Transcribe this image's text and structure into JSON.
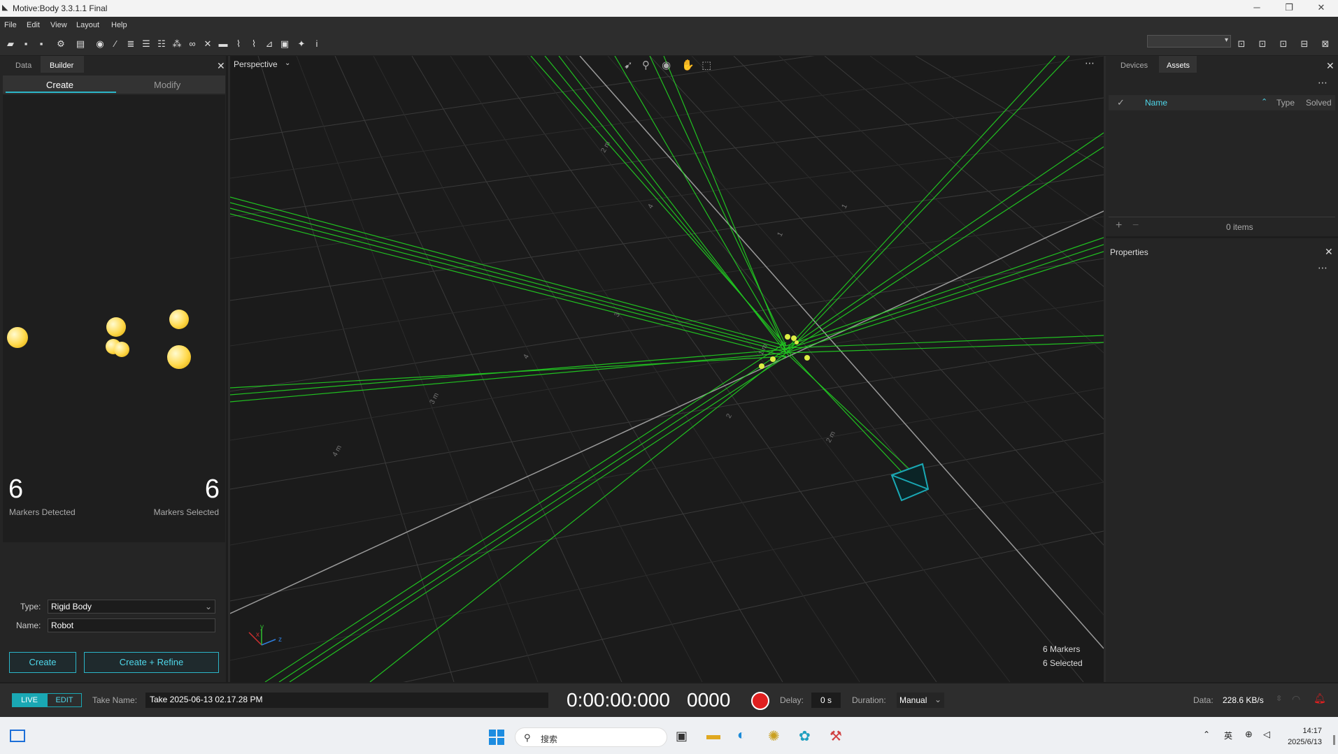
{
  "window": {
    "title": "Motive:Body 3.3.1.1 Final",
    "min": "─",
    "restore": "❐",
    "close": "✕"
  },
  "menu": [
    "File",
    "Edit",
    "View",
    "Layout",
    "Help"
  ],
  "left_panel": {
    "tabs": [
      "Data",
      "Builder"
    ],
    "subtabs": [
      "Create",
      "Modify"
    ],
    "markers_detected": "6",
    "markers_detected_label": "Markers Detected",
    "markers_selected": "6",
    "markers_selected_label": "Markers Selected",
    "type_label": "Type:",
    "type_value": "Rigid Body",
    "name_label": "Name:",
    "name_value": "Robot",
    "create_btn": "Create",
    "create_refine_btn": "Create + Refine"
  },
  "viewport": {
    "view_mode": "Perspective",
    "marker_count": "6 Markers",
    "selected_count": "6 Selected",
    "axis_labels": [
      "x",
      "y",
      "z"
    ],
    "grid_labels": [
      "2 m",
      "3 m",
      "4 m",
      "5 m",
      "1 m",
      "2 m",
      "4",
      "1",
      "3",
      "4",
      "1",
      "2"
    ]
  },
  "right_panel": {
    "tabs": [
      "Devices",
      "Assets"
    ],
    "columns": [
      "Name",
      "Type",
      "Solved"
    ],
    "items_count": "0 items",
    "add": "+",
    "remove": "−",
    "properties_title": "Properties"
  },
  "bottom_bar": {
    "live": "LIVE",
    "edit": "EDIT",
    "take_name_label": "Take Name:",
    "take_name": "Take 2025-06-13 02.17.28 PM",
    "timecode": "0:00:00:000",
    "frame": "0000",
    "delay_label": "Delay:",
    "delay_value": "0 s",
    "duration_label": "Duration:",
    "duration_value": "Manual",
    "data_label": "Data:",
    "data_value": "228.6 KB/s"
  },
  "taskbar": {
    "search_placeholder": "搜索",
    "ime": "英",
    "time": "14:17",
    "date": "2025/6/13"
  },
  "colors": {
    "accent": "#2bb5c8",
    "ray": "#22dd22",
    "record": "#e02020"
  }
}
